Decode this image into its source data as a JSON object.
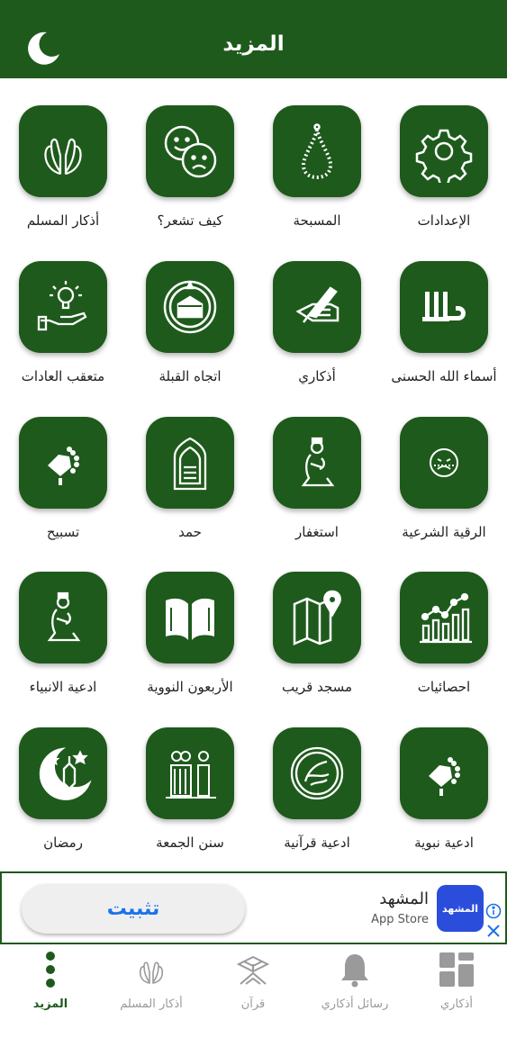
{
  "header": {
    "title": "المزيد",
    "moon_icon": "crescent-moon-icon"
  },
  "grid": {
    "accent": "#1e5a1c",
    "items": [
      {
        "label": "الإعدادات",
        "icon": "gear-icon"
      },
      {
        "label": "المسبحة",
        "icon": "prayer-beads-icon"
      },
      {
        "label": "كيف تشعر؟",
        "icon": "mood-faces-icon"
      },
      {
        "label": "أذكار المسلم",
        "icon": "praying-hands-icon"
      },
      {
        "label": "أسماء الله الحسنى",
        "icon": "allah-calligraphy-icon"
      },
      {
        "label": "أذكاري",
        "icon": "writing-hand-icon"
      },
      {
        "label": "اتجاه القبلة",
        "icon": "kaaba-compass-icon"
      },
      {
        "label": "متعقب العادات",
        "icon": "idea-hand-icon"
      },
      {
        "label": "الرقية الشرعية",
        "icon": "sick-face-icon"
      },
      {
        "label": "استغفار",
        "icon": "praying-man-icon"
      },
      {
        "label": "حمد",
        "icon": "mihrab-icon"
      },
      {
        "label": "تسبيح",
        "icon": "hand-beads-icon"
      },
      {
        "label": "احصائيات",
        "icon": "bar-chart-icon"
      },
      {
        "label": "مسجد قريب",
        "icon": "map-pin-icon"
      },
      {
        "label": "الأربعون النووية",
        "icon": "open-book-icon"
      },
      {
        "label": "ادعية الانبياء",
        "icon": "praying-man-icon"
      },
      {
        "label": "ادعية نبوية",
        "icon": "hand-beads-icon"
      },
      {
        "label": "ادعية قرآنية",
        "icon": "quran-calligraphy-icon"
      },
      {
        "label": "سنن الجمعة",
        "icon": "group-prayer-icon"
      },
      {
        "label": "رمضان",
        "icon": "ramadan-lantern-icon"
      }
    ]
  },
  "ad": {
    "install_label": "تثبيت",
    "app_name": "المشهد",
    "store": "App Store",
    "logo_text": "المشهد",
    "brand_color": "#2b4ddb",
    "install_color": "#1a73e8"
  },
  "tabbar": {
    "tabs": [
      {
        "label": "أذكاري",
        "icon": "dashboard-icon",
        "active": false
      },
      {
        "label": "رسائل أذكاري",
        "icon": "bell-icon",
        "active": false
      },
      {
        "label": "قرآن",
        "icon": "quran-stand-icon",
        "active": false
      },
      {
        "label": "أذكار المسلم",
        "icon": "praying-hands-icon",
        "active": false
      },
      {
        "label": "المزيد",
        "icon": "more-dots-icon",
        "active": true
      }
    ]
  }
}
